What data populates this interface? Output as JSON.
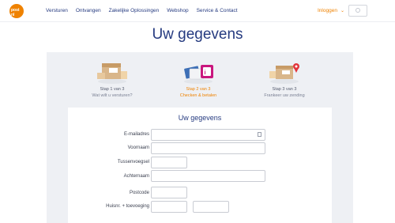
{
  "header": {
    "logo_text": "post nl",
    "nav": [
      "Versturen",
      "Ontvangen",
      "Zakelijke Oplossingen",
      "Webshop",
      "Service & Contact"
    ],
    "login_label": "Inloggen",
    "brand_color": "#ef8200",
    "navy_color": "#263b80"
  },
  "page": {
    "title": "Uw gegevens"
  },
  "steps": [
    {
      "label": "Stap 1 van 3",
      "sub": "Wat wilt u versturen?",
      "icon": "parcel-icon"
    },
    {
      "label": "Stap 2 van 3",
      "sub": "Checken & betalen",
      "icon": "payment-cards-icon"
    },
    {
      "label": "Stap 3 van 3",
      "sub": "Frankeer uw zending",
      "icon": "parcel-location-icon"
    }
  ],
  "form": {
    "title": "Uw gegevens",
    "fields": {
      "email": "E-mailadres",
      "firstname": "Voornaam",
      "infix": "Tussenvoegsel",
      "lastname": "Achternaam",
      "postcode": "Postcode",
      "housenumber": "Huisnr. + toevoeging"
    }
  }
}
